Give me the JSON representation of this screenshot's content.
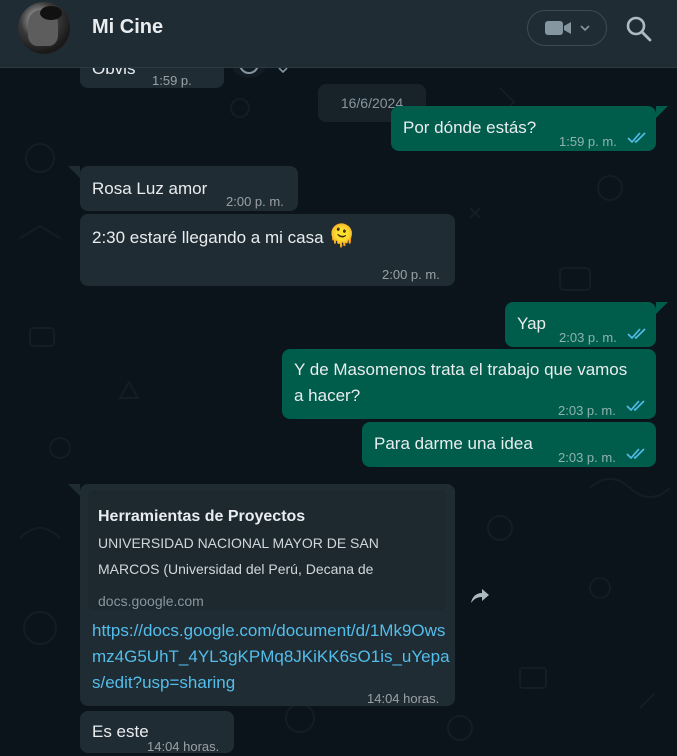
{
  "header": {
    "title": "Mi Cine",
    "video_icon": "video-camera-icon",
    "dropdown_icon": "chevron-down-icon",
    "search_icon": "search-icon"
  },
  "date_chip": "16/6/2024",
  "messages": [
    {
      "id": "m0",
      "direction": "in",
      "text": "Obvis",
      "time": "1:59 p."
    },
    {
      "id": "m1",
      "direction": "out",
      "text": "Por dónde estás?",
      "time": "1:59 p. m.",
      "status": "read"
    },
    {
      "id": "m2",
      "direction": "in",
      "text": "Rosa Luz amor",
      "time": "2:00 p. m."
    },
    {
      "id": "m3",
      "direction": "in",
      "text": "2:30 estaré llegando a mi casa",
      "emoji": "🫠",
      "time": "2:00 p. m."
    },
    {
      "id": "m4",
      "direction": "out",
      "text": "Yap",
      "time": "2:03 p. m.",
      "status": "read"
    },
    {
      "id": "m5",
      "direction": "out",
      "text": "Y de Masomenos trata el trabajo que vamos a hacer?",
      "time": "2:03 p. m.",
      "status": "read"
    },
    {
      "id": "m6",
      "direction": "out",
      "text": "Para darme una idea",
      "time": "2:03 p. m.",
      "status": "read"
    },
    {
      "id": "m7",
      "direction": "in",
      "link_preview": {
        "title": "Herramientas de Proyectos",
        "description": "UNIVERSIDAD NACIONAL MAYOR DE SAN MARCOS (Universidad del Perú, Decana de",
        "domain": "docs.google.com"
      },
      "text": "https://docs.google.com/document/d/1Mk9Owsmz4G5UhT_4YL3gKPMq8JKiKK6sO1is_uYepas/edit?usp=sharing",
      "time": "14:04 horas."
    },
    {
      "id": "m8",
      "direction": "in",
      "text": "Es este",
      "time": "14:04 horas."
    }
  ],
  "colors": {
    "background": "#0b141a",
    "header": "#202c33",
    "incoming": "#202c33",
    "outgoing": "#005c4b",
    "link": "#53bdeb",
    "read_ticks": "#53bdeb"
  }
}
